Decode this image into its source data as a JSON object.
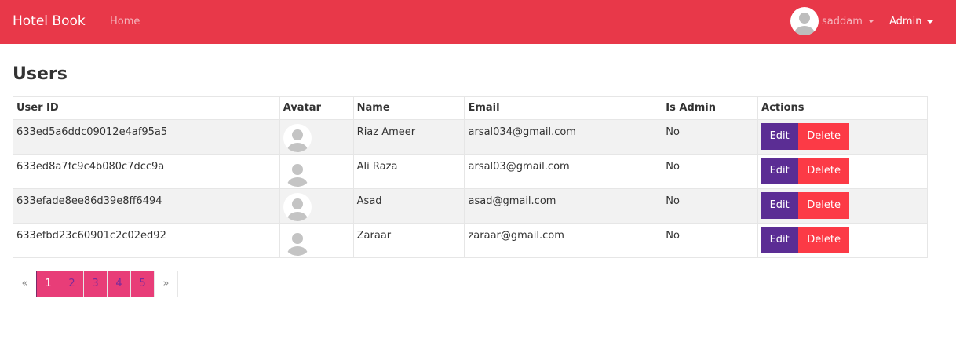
{
  "navbar": {
    "brand": "Hotel Book",
    "home_link": "Home",
    "user_name": "saddam",
    "admin_label": "Admin"
  },
  "page": {
    "title": "Users"
  },
  "table": {
    "headers": [
      "User ID",
      "Avatar",
      "Name",
      "Email",
      "Is Admin",
      "Actions"
    ],
    "rows": [
      {
        "id": "633ed5a6ddc09012e4af95a5",
        "name": "Riaz Ameer",
        "email": "arsal034@gmail.com",
        "is_admin": "No"
      },
      {
        "id": "633ed8a7fc9c4b080c7dcc9a",
        "name": "Ali Raza",
        "email": "arsal03@gmail.com",
        "is_admin": "No"
      },
      {
        "id": "633efade8ee86d39e8ff6494",
        "name": "Asad",
        "email": "asad@gmail.com",
        "is_admin": "No"
      },
      {
        "id": "633efbd23c60901c2c02ed92",
        "name": "Zaraar",
        "email": "zaraar@gmail.com",
        "is_admin": "No"
      }
    ],
    "edit_label": "Edit",
    "delete_label": "Delete"
  },
  "pagination": {
    "prev": "«",
    "pages": [
      "1",
      "2",
      "3",
      "4",
      "5"
    ],
    "next": "»",
    "active_page": "1"
  },
  "colors": {
    "navbar": "#e83849",
    "edit_button": "#5b2d94",
    "delete_button": "#fc3a46",
    "page_button": "#e83d78"
  },
  "icons": {
    "avatar": "user-avatar-icon",
    "caret": "caret-down-icon"
  }
}
